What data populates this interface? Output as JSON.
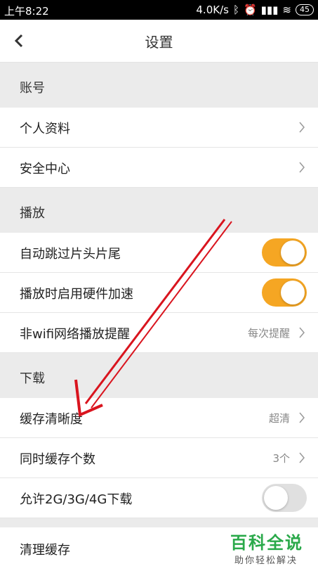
{
  "status_bar": {
    "time": "上午8:22",
    "network_speed": "4.0K/s",
    "battery": "45"
  },
  "header": {
    "title": "设置"
  },
  "sections": {
    "account": {
      "title": "账号",
      "profile": "个人资料",
      "security": "安全中心"
    },
    "playback": {
      "title": "播放",
      "skip_intro": "自动跳过片头片尾",
      "skip_intro_on": true,
      "hw_accel": "播放时启用硬件加速",
      "hw_accel_on": true,
      "non_wifi": "非wifi网络播放提醒",
      "non_wifi_value": "每次提醒"
    },
    "download": {
      "title": "下载",
      "quality": "缓存清晰度",
      "quality_value": "超清",
      "concurrent": "同时缓存个数",
      "concurrent_value": "3个",
      "allow_cellular": "允许2G/3G/4G下载",
      "allow_cellular_on": false
    },
    "misc": {
      "clear_cache": "清理缓存"
    }
  },
  "watermark": {
    "main": "百科全说",
    "sub": "助你轻松解决"
  },
  "colors": {
    "toggle_on": "#f5a623",
    "toggle_off": "#e0e0e0",
    "arrow": "#d9141e",
    "watermark": "#2aa94a"
  }
}
